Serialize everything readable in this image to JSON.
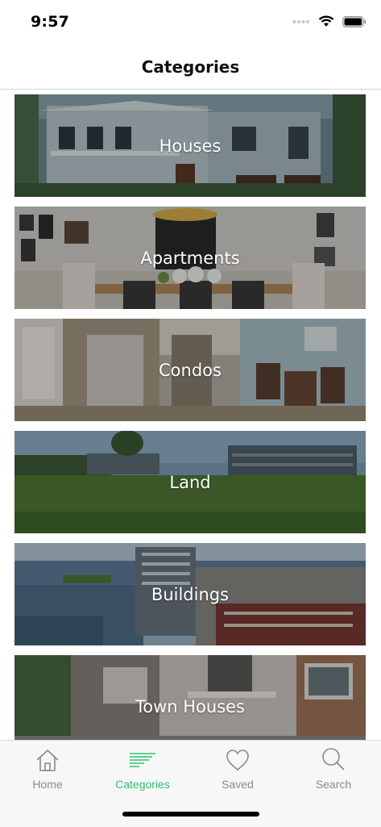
{
  "status": {
    "time": "9:57"
  },
  "header": {
    "title": "Categories"
  },
  "categories": [
    {
      "label": "Houses"
    },
    {
      "label": "Apartments"
    },
    {
      "label": "Condos"
    },
    {
      "label": "Land"
    },
    {
      "label": "Buildings"
    },
    {
      "label": "Town Houses"
    }
  ],
  "tabs": [
    {
      "label": "Home",
      "icon": "home-icon"
    },
    {
      "label": "Categories",
      "icon": "categories-icon"
    },
    {
      "label": "Saved",
      "icon": "heart-icon"
    },
    {
      "label": "Search",
      "icon": "search-icon"
    }
  ],
  "colors": {
    "accent": "#2fbf71",
    "inactive": "#8a8a8a"
  }
}
